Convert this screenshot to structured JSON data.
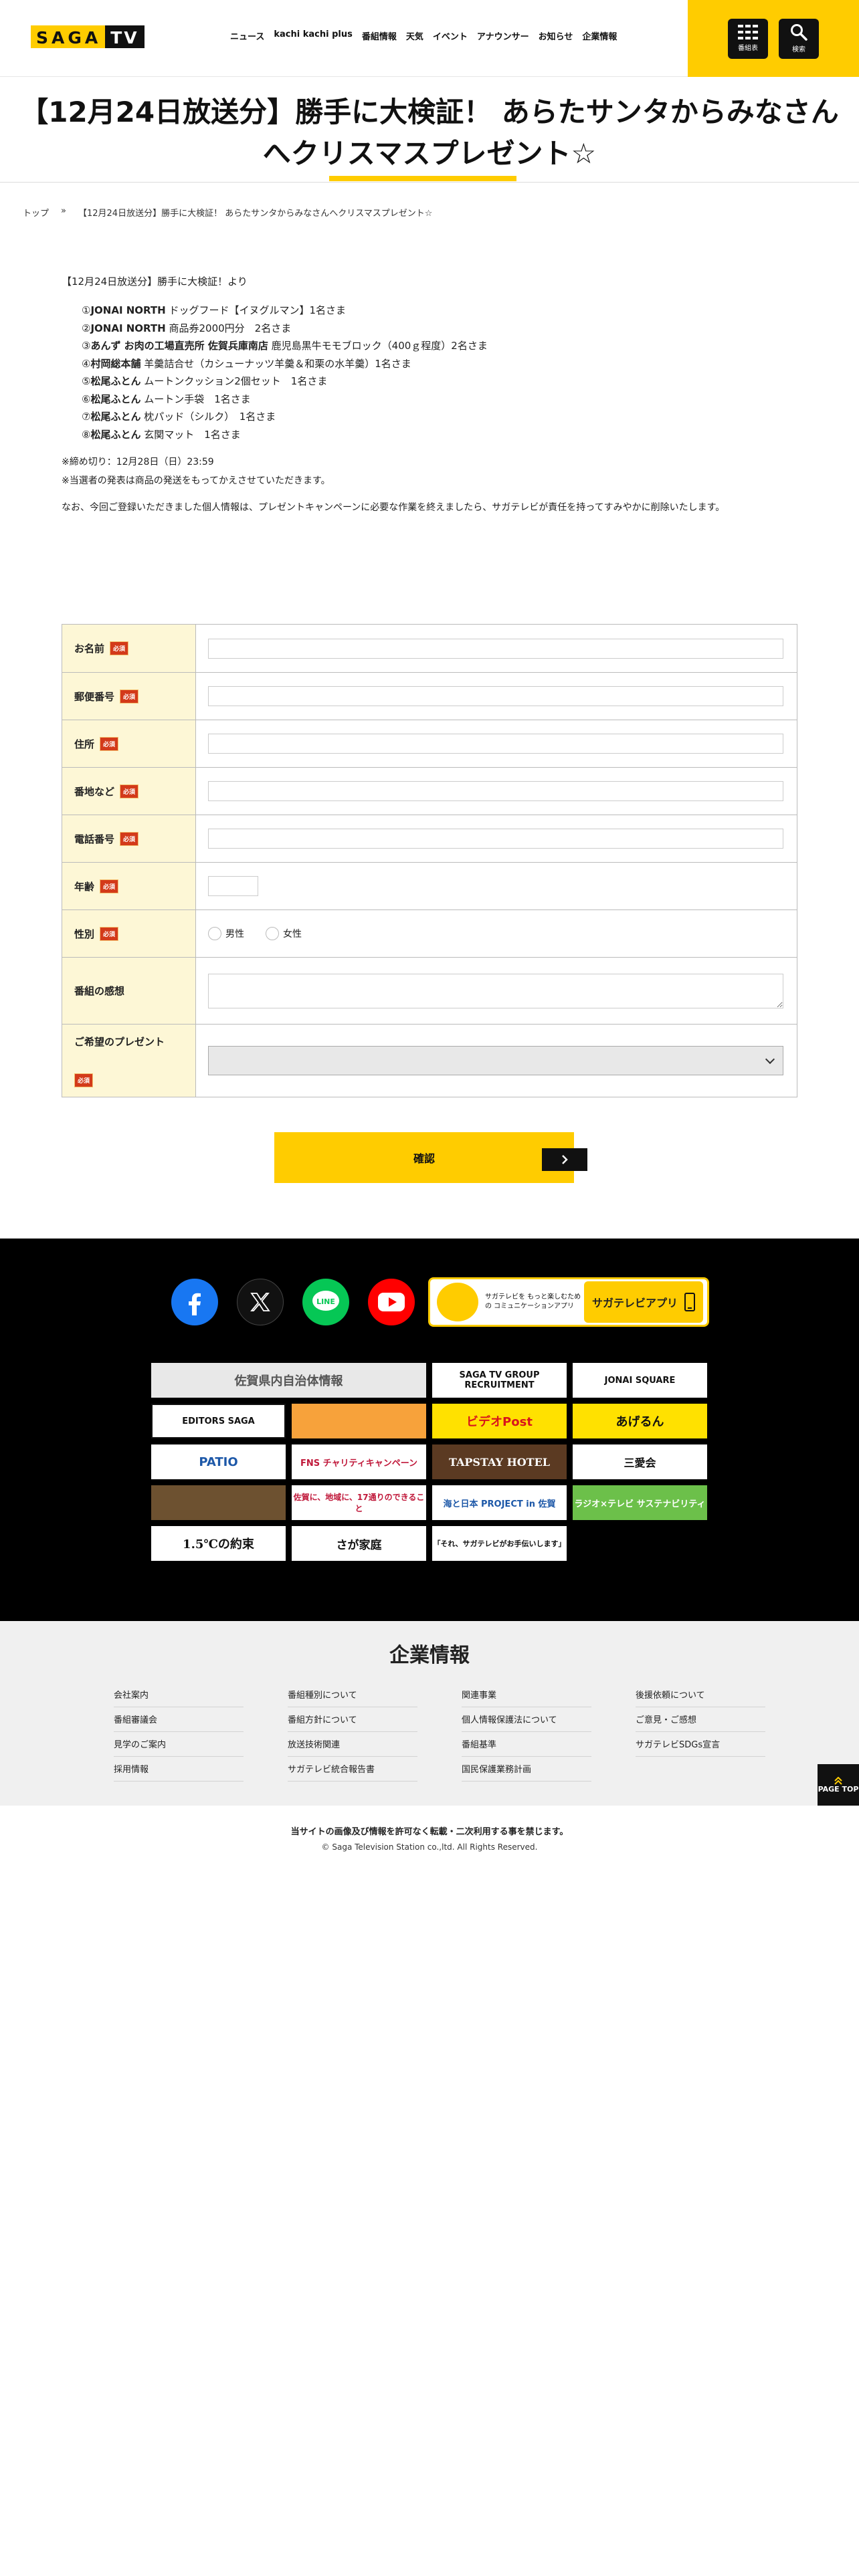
{
  "header": {
    "logo_saga": "SAGA",
    "logo_tv": "TV",
    "nav": [
      "ニュース",
      "kachi kachi plus",
      "番組情報",
      "天気",
      "イベント",
      "アナウンサー",
      "お知らせ",
      "企業情報"
    ],
    "program_btn": "番組表",
    "search_btn": "検索"
  },
  "title": "【12月24日放送分】勝手に大検証！ あらたサンタからみなさんへクリスマスプレゼント☆",
  "breadcrumb": {
    "home": "トップ",
    "sep": "»",
    "current": "【12月24日放送分】勝手に大検証！ あらたサンタからみなさんへクリスマスプレゼント☆"
  },
  "lead": "【12月24日放送分】勝手に大検証！より",
  "prizes": [
    {
      "num": "①",
      "brand": "JONAI NORTH",
      "item": " ドッグフード【イヌグルマン】1名さま"
    },
    {
      "num": "②",
      "brand": "JONAI NORTH",
      "item": " 商品券2000円分　2名さま"
    },
    {
      "num": "③",
      "brand": "あんず お肉の工場直売所 佐賀兵庫南店",
      "item": " 鹿児島黒牛モモブロック（400ｇ程度）2名さま"
    },
    {
      "num": "④",
      "brand": "村岡総本舗",
      "item": " 羊羹詰合せ（カシューナッツ羊羹＆和栗の水羊羹）1名さま"
    },
    {
      "num": "⑤",
      "brand": "松尾ふとん",
      "item": " ムートンクッション2個セット　1名さま"
    },
    {
      "num": "⑥",
      "brand": "松尾ふとん",
      "item": " ムートン手袋　1名さま"
    },
    {
      "num": "⑦",
      "brand": "松尾ふとん",
      "item": " 枕パッド（シルク）　1名さま"
    },
    {
      "num": "⑧",
      "brand": "松尾ふとん",
      "item": " 玄関マット　1名さま"
    }
  ],
  "notes": [
    "※締め切り：12月28日（日）23:59",
    "※当選者の発表は商品の発送をもってかえさせていただきます。"
  ],
  "privacy": "なお、今回ご登録いただきました個人情報は、プレゼントキャンペーンに必要な作業を終えましたら、サガテレビが責任を持ってすみやかに削除いたします。",
  "form": {
    "required": "必須",
    "name": "お名前",
    "zip": "郵便番号",
    "address": "住所",
    "address2": "番地など",
    "phone": "電話番号",
    "age": "年齢",
    "gender": "性別",
    "male": "男性",
    "female": "女性",
    "impression": "番組の感想",
    "prize": "ご希望のプレゼント",
    "confirm": "確認"
  },
  "footer": {
    "sns": [
      "facebook",
      "X",
      "LINE",
      "YouTube"
    ],
    "app_desc": "サガテレビを もっと楽しむための コミュニケーションアプリ",
    "app_name": "サガテレビアプリ",
    "banners": [
      [
        "佐賀県内自治体情報",
        "SAGA TV GROUP RECRUITMENT",
        "JONAI SQUARE"
      ],
      [
        "EDITORS SAGA",
        "",
        "ビデオPost",
        "あげるん"
      ],
      [
        "PATIO",
        "FNS チャリティキャンペーン",
        "TAPSTAY HOTEL",
        "三愛会"
      ],
      [
        "",
        "佐賀に、地域に、17通りのできること",
        "海と日本 PROJECT in 佐賀",
        "ラジオ×テレビ サステナビリティ"
      ],
      [
        "1.5℃の約束",
        "さが家庭",
        "「それ、サガテレビがお手伝いします」"
      ]
    ]
  },
  "corp": {
    "title": "企業情報",
    "cols": [
      [
        "会社案内",
        "番組審議会",
        "見学のご案内",
        "採用情報"
      ],
      [
        "番組種別について",
        "番組方針について",
        "放送技術関連",
        "サガテレビ統合報告書"
      ],
      [
        "関連事業",
        "個人情報保護法について",
        "番組基準",
        "国民保護業務計画"
      ],
      [
        "後援依頼について",
        "ご意見・ご感想",
        "サガテレビSDGs宣言"
      ]
    ],
    "pagetop": "PAGE TOP"
  },
  "copy": {
    "notice": "当サイトの画像及び情報を許可なく転載・二次利用する事を禁じます。",
    "rights": "© Saga Television Station co.,ltd. All Rights Reserved."
  }
}
